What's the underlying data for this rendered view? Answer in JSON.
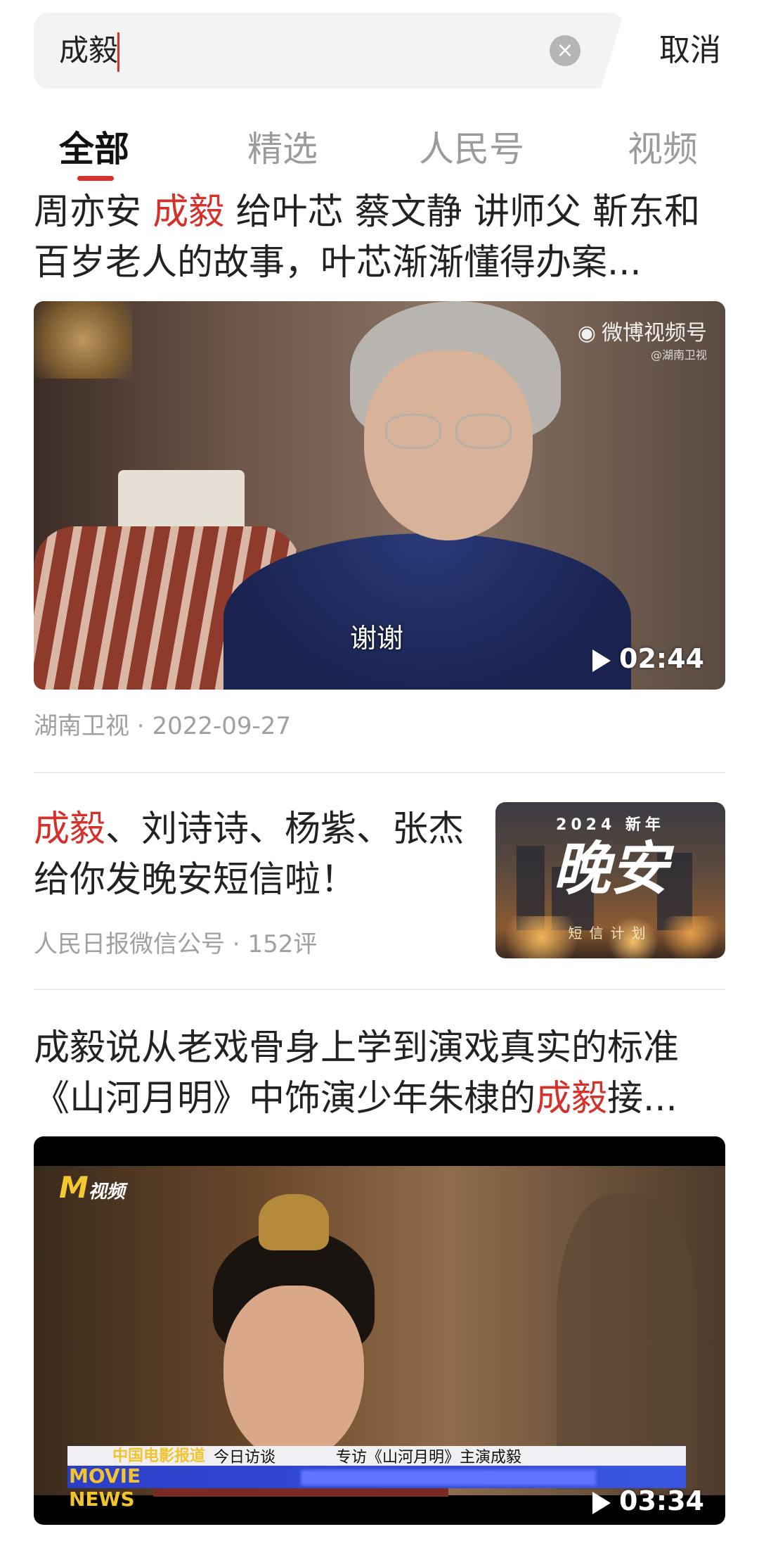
{
  "search": {
    "query": "成毅",
    "clear_icon": "close-icon",
    "cancel_label": "取消"
  },
  "tabs": [
    {
      "label": "全部",
      "active": true
    },
    {
      "label": "精选",
      "active": false
    },
    {
      "label": "人民号",
      "active": false
    },
    {
      "label": "视频",
      "active": false
    }
  ],
  "articles": [
    {
      "title_pre": "周亦安 ",
      "title_hl": "成毅",
      "title_post": " 给叶芯 蔡文静 讲师父 靳东和百岁老人的故事，叶芯渐渐懂得办案...",
      "video": {
        "watermark": "微博视频号",
        "watermark_sub": "@湖南卫视",
        "subtitle": "谢谢",
        "duration": "02:44"
      },
      "source": "湖南卫视",
      "date": "2022-09-27"
    },
    {
      "title_hl": "成毅",
      "title_post": "、刘诗诗、杨紫、张杰给你发晚安短信啦！",
      "thumb": {
        "year_text": "2024 新年",
        "big_text": "晚安",
        "sub_text": "短信计划"
      },
      "source": "人民日报微信公号",
      "comments": "152评"
    },
    {
      "title_pre": "成毅说从老戏骨身上学到演戏真实的标准《山河月明》中饰演少年朱棣的",
      "title_hl": "成毅",
      "title_post": "接...",
      "video": {
        "logo": "M",
        "logo_sub": "视频",
        "news_cn": "中国电影报道",
        "news_en": "MOVIE NEWS",
        "banner_tag": "今日访谈",
        "banner_text": "专访《山河月明》主演成毅",
        "duration": "03:34"
      }
    }
  ],
  "colors": {
    "accent": "#d6302a",
    "meta_gray": "#a0a0a0"
  }
}
